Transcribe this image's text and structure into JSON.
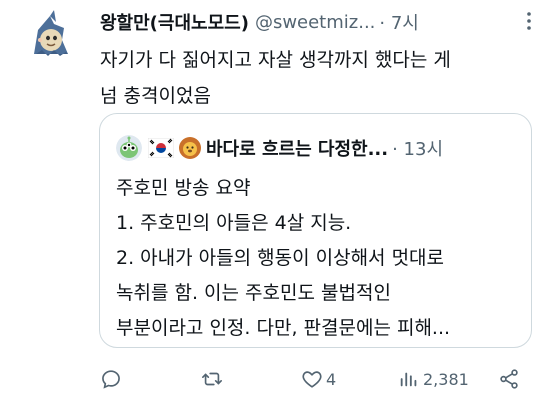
{
  "tweet": {
    "author_name": "왕할만(극대노모드)",
    "handle": "@sweetmiz...",
    "time": "· 7시",
    "text_line1": "자기가 다 짊어지고 자살 생각까지 했다는 게",
    "text_line2": "넘 충격이었음"
  },
  "quote": {
    "author_name": "바다로 흐르는 다정한...",
    "time": "· 13시",
    "lines": [
      "주호민 방송 요약",
      "1. 주호민의 아들은 4살 지능.",
      "2. 아내가 아들의 행동이 이상해서 멋대로",
      "녹취를 함. 이는 주호민도 불법적인",
      "부분이라고 인정. 다만, 판결문에는 피해..."
    ]
  },
  "actions": {
    "reply_count": "",
    "retweet_count": "",
    "like_count": "4",
    "views_count": "2,381"
  },
  "colors": {
    "text": "#0f1419",
    "secondary": "#536471",
    "border": "#cfd9de"
  },
  "icons": [
    "shark-avatar",
    "more-icon",
    "alien-avatar",
    "korea-flag-icon",
    "lion-icon",
    "reply-icon",
    "retweet-icon",
    "like-icon",
    "views-icon",
    "share-icon"
  ]
}
